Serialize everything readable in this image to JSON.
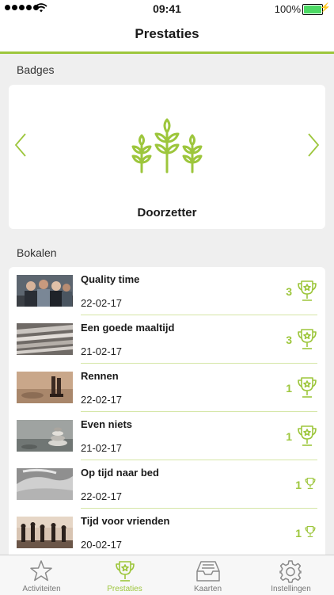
{
  "status": {
    "time": "09:41",
    "battery": "100%"
  },
  "navbar": {
    "title": "Prestaties"
  },
  "sections": {
    "badges": "Badges",
    "trophies": "Bokalen"
  },
  "badge": {
    "name": "Doorzetter",
    "icon": "wheat-icon"
  },
  "trophies": [
    {
      "title": "Quality time",
      "date": "22-02-17",
      "count": "3",
      "icon": "trophy-icon"
    },
    {
      "title": "Een goede maaltijd",
      "date": "21-02-17",
      "count": "3",
      "icon": "trophy-icon"
    },
    {
      "title": "Rennen",
      "date": "22-02-17",
      "count": "1",
      "icon": "trophy-icon"
    },
    {
      "title": "Even niets",
      "date": "21-02-17",
      "count": "1",
      "icon": "trophy-icon"
    },
    {
      "title": "Op tijd naar bed",
      "date": "22-02-17",
      "count": "1",
      "icon": "trophy-icon"
    },
    {
      "title": "Tijd voor vrienden",
      "date": "20-02-17",
      "count": "1",
      "icon": "trophy-icon"
    }
  ],
  "tabs": [
    {
      "label": "Activiteiten",
      "icon": "star-icon"
    },
    {
      "label": "Prestaties",
      "icon": "trophy-icon",
      "active": true
    },
    {
      "label": "Kaarten",
      "icon": "inbox-tray-icon"
    },
    {
      "label": "Instellingen",
      "icon": "gear-icon"
    }
  ],
  "colors": {
    "accent": "#9dc63c",
    "background": "#efefef"
  }
}
